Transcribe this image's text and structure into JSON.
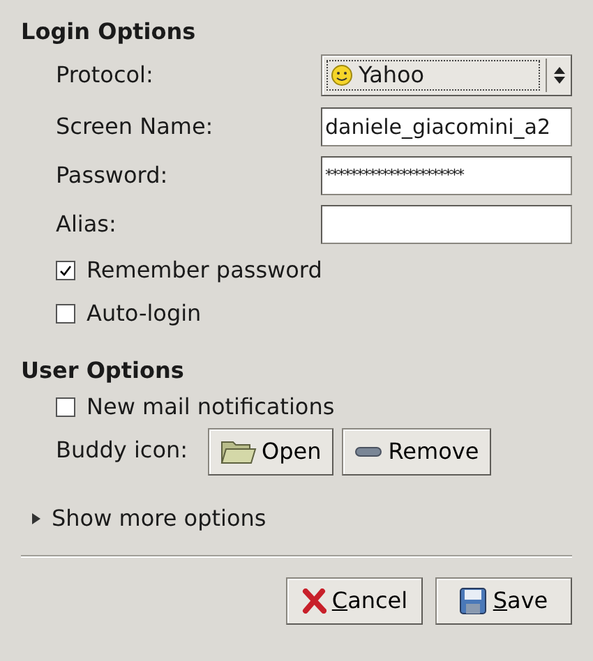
{
  "login_options": {
    "title": "Login Options",
    "protocol": {
      "label": "Protocol:",
      "value": "Yahoo"
    },
    "fields": [
      {
        "label": "Screen Name:",
        "value": "daniele_giacomini_a2"
      },
      {
        "label": "Password:",
        "kind": "password",
        "value": "**********************"
      },
      {
        "label": "Alias:"
      }
    ],
    "checkboxes": [
      {
        "label": "Remember password",
        "checked": true
      },
      {
        "label": "Auto-login",
        "checked": false
      }
    ]
  },
  "user_options": {
    "title": "User Options",
    "checkboxes": [
      {
        "label": "New mail notifications",
        "checked": false
      }
    ],
    "buddy_icon": {
      "label": "Buddy icon:",
      "buttons": [
        {
          "kind": "open",
          "label": "Open"
        },
        {
          "kind": "remove",
          "label": "Remove"
        }
      ]
    }
  },
  "expander": {
    "label": "Show more options",
    "expanded": false
  },
  "buttons": [
    {
      "kind": "cancel",
      "label": "Cancel"
    },
    {
      "kind": "save",
      "label": "Save"
    }
  ]
}
